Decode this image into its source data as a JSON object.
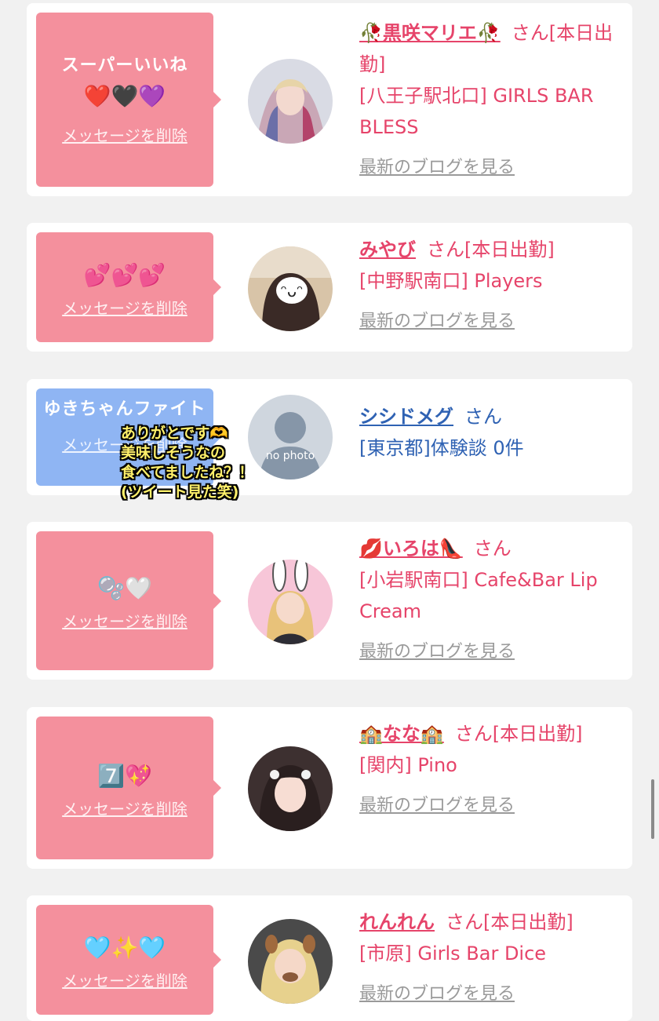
{
  "common": {
    "delete_label": "メッセージを削除",
    "blog_label": "最新のブログを見る",
    "san": "さん"
  },
  "cards": [
    {
      "message": "スーパーいいね",
      "emoji": "❤️🖤💜",
      "name": "🥀黒咲マリエ🥀",
      "suffix": "さん[本日出勤]",
      "shop": "[八王子駅北口] GIRLS BAR BLESS",
      "has_blog": true,
      "color": "#f4909d"
    },
    {
      "message": "",
      "emoji": "💕💕💕",
      "name": "みやび",
      "suffix": "さん[本日出勤]",
      "shop": "[中野駅南口] Players",
      "has_blog": true,
      "color": "#f4909d"
    },
    {
      "message": "ゆきちゃんファイト",
      "emoji": "",
      "name": "シシドメグ",
      "suffix": "さん",
      "shop": "[東京都]体験談 0件",
      "has_blog": false,
      "avatar_text": "no photo",
      "color": "#8fb5f3"
    },
    {
      "message": "",
      "emoji": "🫧🤍",
      "name": "💋いろは👠",
      "suffix": "さん",
      "shop": "[小岩駅南口] Cafe&Bar Lip Cream",
      "has_blog": true,
      "color": "#f4909d"
    },
    {
      "message": "",
      "emoji": "7️⃣💖",
      "name": "🏫なな🏫",
      "suffix": "さん[本日出勤]",
      "shop": "[関内] Pino",
      "has_blog": true,
      "color": "#f4909d"
    },
    {
      "message": "",
      "emoji": "🩵✨🩵",
      "name": "れんれん",
      "suffix": "さん[本日出勤]",
      "shop": "[市原] Girls Bar Dice",
      "has_blog": true,
      "color": "#f4909d"
    }
  ],
  "overlay_caption": "ありがとです🫶\n美味しそうなの\n食べてましたね？！\n(ツイート見た笑)"
}
